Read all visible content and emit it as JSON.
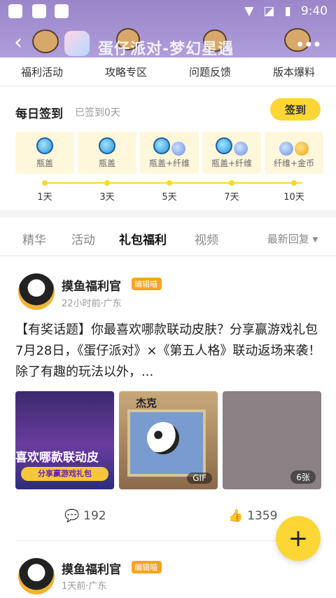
{
  "status_bar": {
    "time": "9:40"
  },
  "header": {
    "title": "蛋仔派对-梦幻星遇",
    "back": "‹",
    "more": "•••"
  },
  "top_nav": [
    "福利活动",
    "攻略专区",
    "问题反馈",
    "版本爆料"
  ],
  "signin": {
    "title": "每日签到",
    "status": "已签到0天",
    "button": "签到",
    "rewards": [
      {
        "label": "瓶盖",
        "day": "1天"
      },
      {
        "label": "瓶盖",
        "day": "3天"
      },
      {
        "label": "瓶盖+纤维",
        "day": "5天"
      },
      {
        "label": "瓶盖+纤维",
        "day": "7天"
      },
      {
        "label": "纤维+金币",
        "day": "10天"
      }
    ]
  },
  "content_tabs": [
    "精华",
    "活动",
    "礼包福利",
    "视频"
  ],
  "sort": "最新回复 ▾",
  "posts": [
    {
      "author": "摸鱼福利官",
      "badge": "编辑喵",
      "meta": "22小时前·广东",
      "text": "【有奖话题】你最喜欢哪款联动皮肤？分享赢游戏礼包 7月28日，《蛋仔派对》×《第五人格》联动返场来袭！除了有趣的玩法以外，...",
      "img1_title": "喜欢哪款联动皮",
      "img1_sub": "分享赢游戏礼包",
      "img2_header": "杰克",
      "img2_tag": "GIF",
      "img3_tag": "6张",
      "comments": "192",
      "likes": "1359"
    },
    {
      "author": "摸鱼福利官",
      "badge": "编辑喵",
      "meta": "1天前·广东"
    }
  ],
  "fab": "+"
}
